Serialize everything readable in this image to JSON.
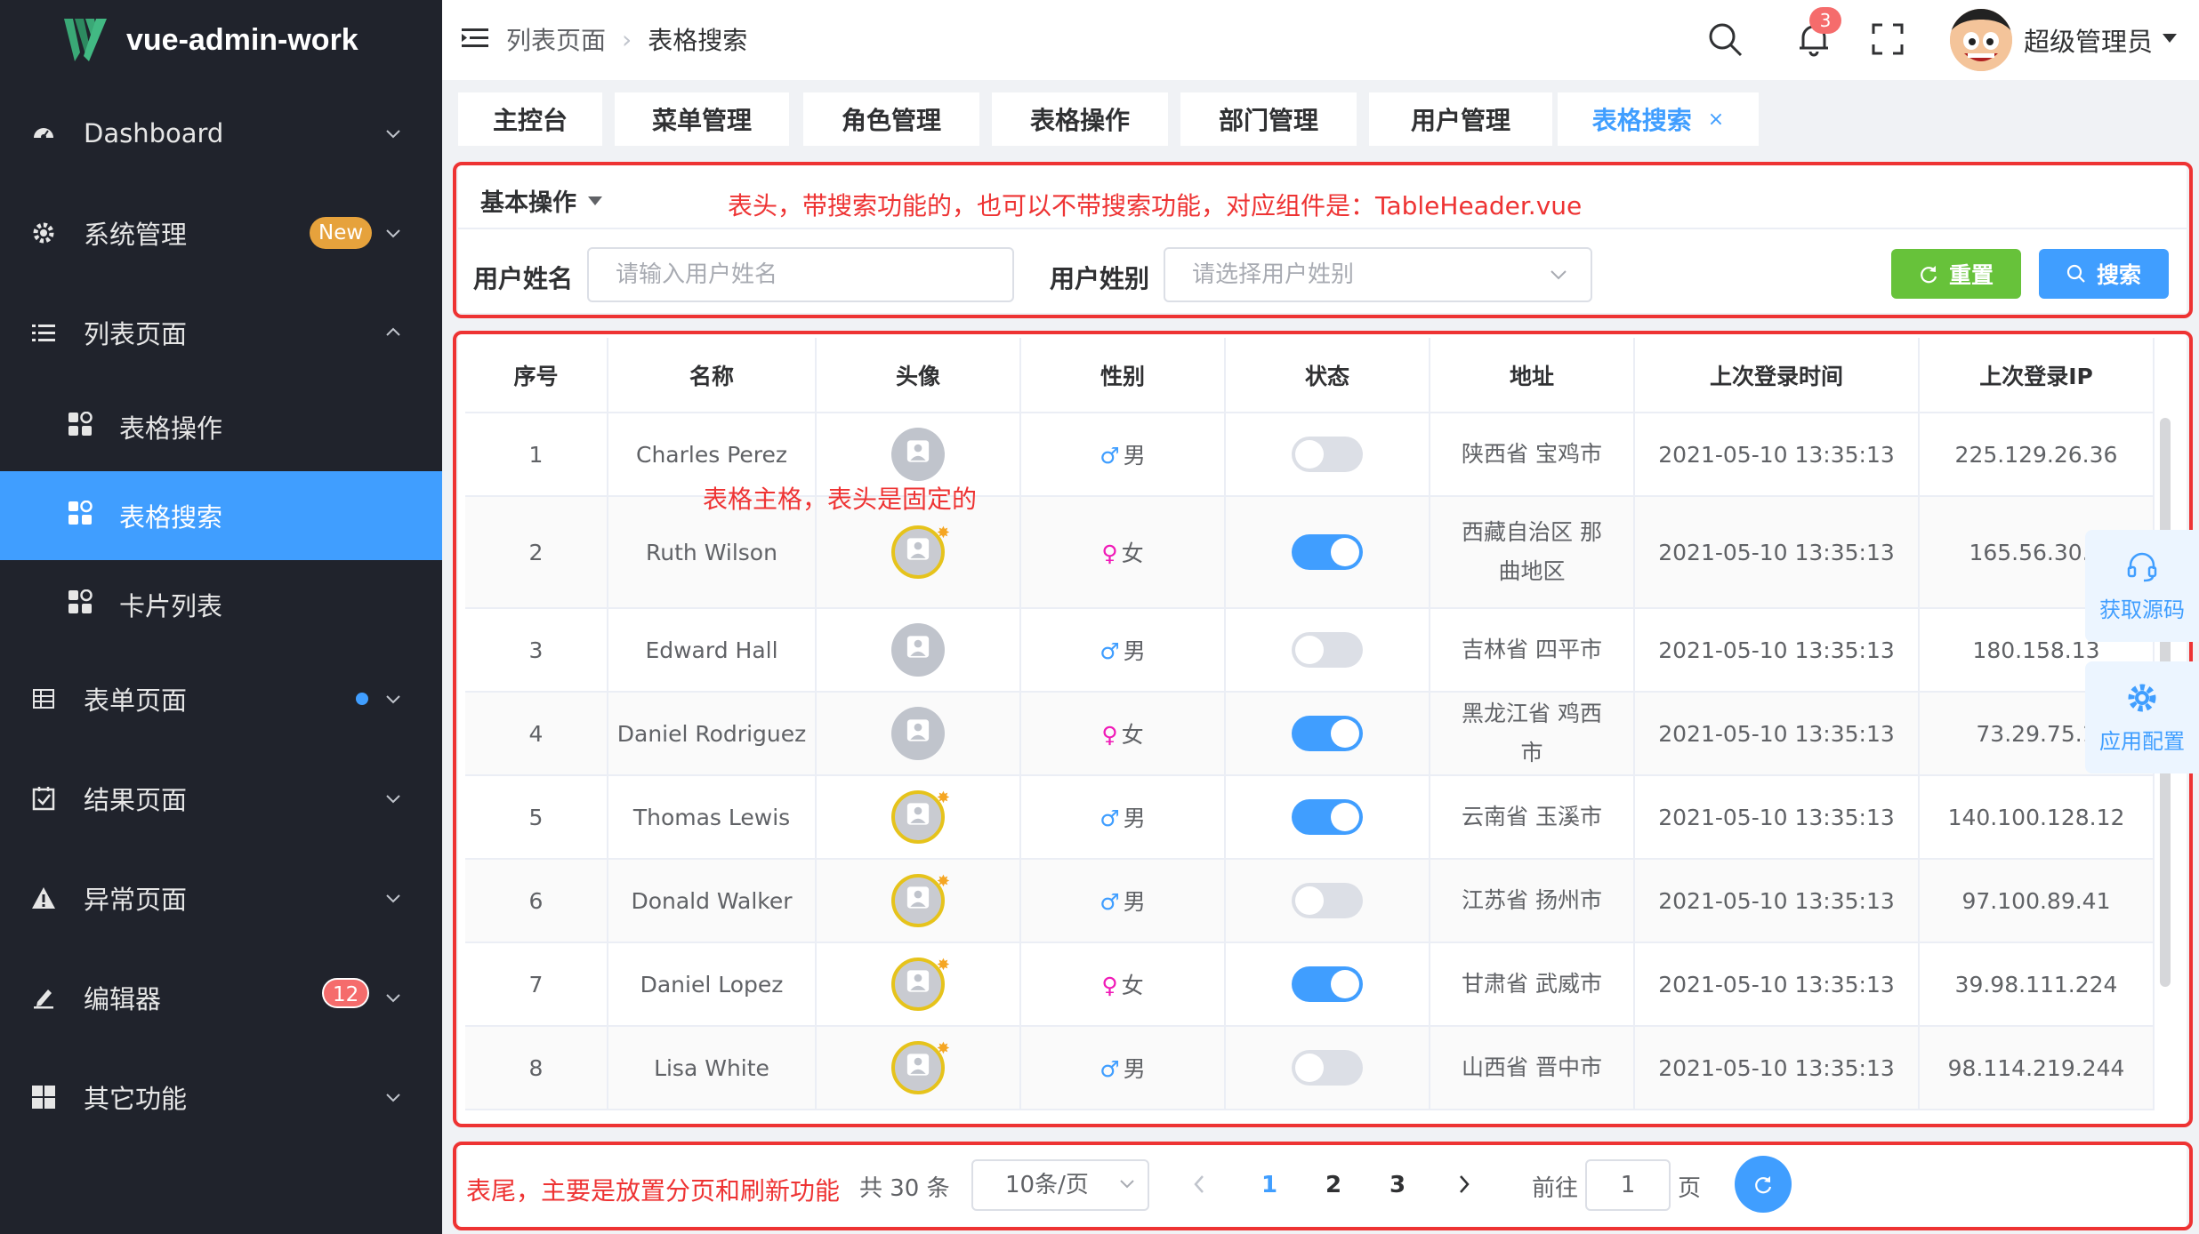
{
  "app": {
    "title": "vue-admin-work"
  },
  "sidebar": {
    "items": [
      {
        "label": "Dashboard",
        "icon": "dashboard-icon"
      },
      {
        "label": "系统管理",
        "icon": "gear-icon",
        "badge": "New"
      },
      {
        "label": "列表页面",
        "icon": "list-icon",
        "expanded": true
      },
      {
        "label": "表单页面",
        "icon": "table-icon",
        "dot": true
      },
      {
        "label": "结果页面",
        "icon": "checklist-icon"
      },
      {
        "label": "异常页面",
        "icon": "warning-icon"
      },
      {
        "label": "编辑器",
        "icon": "edit-icon",
        "badge": "12"
      },
      {
        "label": "其它功能",
        "icon": "grid-icon"
      }
    ],
    "sub_items": [
      {
        "label": "表格操作",
        "active": false
      },
      {
        "label": "表格搜索",
        "active": true
      },
      {
        "label": "卡片列表",
        "active": false
      }
    ]
  },
  "header": {
    "breadcrumb": [
      "列表页面",
      "表格搜索"
    ],
    "notification_count": "3",
    "user_name": "超级管理员"
  },
  "tabs": [
    {
      "label": "主控台"
    },
    {
      "label": "菜单管理"
    },
    {
      "label": "角色管理"
    },
    {
      "label": "表格操作"
    },
    {
      "label": "部门管理"
    },
    {
      "label": "用户管理"
    },
    {
      "label": "表格搜索",
      "active": true,
      "close": "×"
    }
  ],
  "annotations": {
    "header_note": "表头，带搜索功能的，也可以不带搜索功能，对应组件是：TableHeader.vue",
    "body_note": "表格主格，表头是固定的",
    "footer_note": "表尾，主要是放置分页和刷新功能"
  },
  "search": {
    "basic_ops": "基本操作",
    "name_label": "用户姓名",
    "name_placeholder": "请输入用户姓名",
    "gender_label": "用户姓别",
    "gender_placeholder": "请选择用户姓别",
    "reset_label": "重置",
    "search_label": "搜索"
  },
  "table": {
    "columns": [
      "序号",
      "名称",
      "头像",
      "性别",
      "状态",
      "地址",
      "上次登录时间",
      "上次登录IP"
    ],
    "rows": [
      {
        "index": "1",
        "name": "Charles Perez",
        "avatar_style": "gray",
        "gender": "男",
        "status_on": false,
        "address": "陕西省 宝鸡市",
        "time": "2021-05-10 13:35:13",
        "ip": "225.129.26.36"
      },
      {
        "index": "2",
        "name": "Ruth Wilson",
        "avatar_style": "gold",
        "gender": "女",
        "status_on": true,
        "address": "西藏自治区 那曲地区",
        "time": "2021-05-10 13:35:13",
        "ip": "165.56.30.1"
      },
      {
        "index": "3",
        "name": "Edward Hall",
        "avatar_style": "gray",
        "gender": "男",
        "status_on": false,
        "address": "吉林省 四平市",
        "time": "2021-05-10 13:35:13",
        "ip": "180.158.13"
      },
      {
        "index": "4",
        "name": "Daniel Rodriguez",
        "avatar_style": "gray",
        "gender": "女",
        "status_on": true,
        "address": "黑龙江省 鸡西市",
        "time": "2021-05-10 13:35:13",
        "ip": "73.29.75.1"
      },
      {
        "index": "5",
        "name": "Thomas Lewis",
        "avatar_style": "gold",
        "gender": "男",
        "status_on": true,
        "address": "云南省 玉溪市",
        "time": "2021-05-10 13:35:13",
        "ip": "140.100.128.12"
      },
      {
        "index": "6",
        "name": "Donald Walker",
        "avatar_style": "gold",
        "gender": "男",
        "status_on": false,
        "address": "江苏省 扬州市",
        "time": "2021-05-10 13:35:13",
        "ip": "97.100.89.41"
      },
      {
        "index": "7",
        "name": "Daniel Lopez",
        "avatar_style": "gold",
        "gender": "女",
        "status_on": true,
        "address": "甘肃省 武威市",
        "time": "2021-05-10 13:35:13",
        "ip": "39.98.111.224"
      },
      {
        "index": "8",
        "name": "Lisa White",
        "avatar_style": "gold",
        "gender": "男",
        "status_on": false,
        "address": "山西省 晋中市",
        "time": "2021-05-10 13:35:13",
        "ip": "98.114.219.244"
      }
    ]
  },
  "float_panel": {
    "get_source": "获取源码",
    "app_config": "应用配置"
  },
  "pagination": {
    "total": "共 30 条",
    "page_size": "10条/页",
    "pages": [
      "1",
      "2",
      "3"
    ],
    "current_page": "1",
    "goto_label": "前往",
    "goto_value": "1",
    "page_suffix": "页"
  },
  "colors": {
    "primary": "#409eff",
    "success": "#67c23a",
    "danger": "#f56c6c",
    "sidebar": "#20232c",
    "annotation": "#ee3333"
  }
}
